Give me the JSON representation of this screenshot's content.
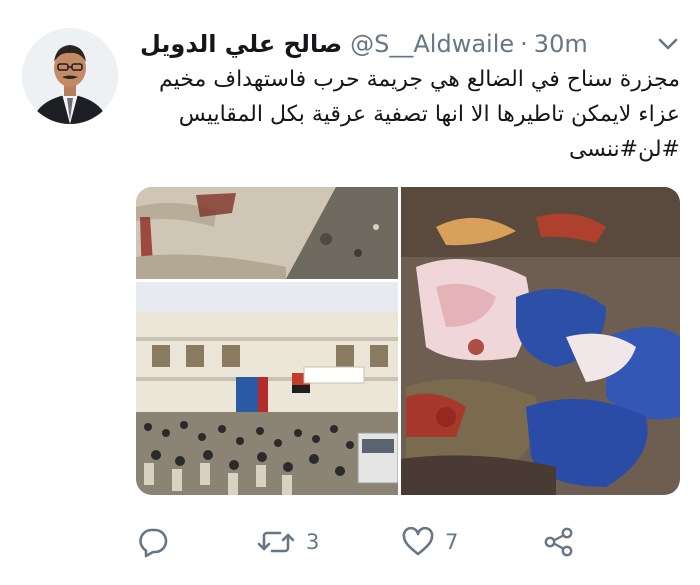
{
  "tweet": {
    "author": {
      "display_name": "صالح علي الدويل",
      "handle": "@S__Aldwaile",
      "separator": "·",
      "time": "30m"
    },
    "text_lines": [
      "مجزرة سناح في الضالع هي جريمة حرب فاستهداف مخيم",
      "عزاء لايمكن تاطيرها الا انها تصفية عرقية بكل المقاييس",
      "#لن#ننسى"
    ],
    "stats": {
      "retweets": "3",
      "likes": "7"
    },
    "media": {
      "images": [
        "photo-rubble-wall",
        "photo-school-building-crowd",
        "photo-covered-bodies"
      ]
    }
  },
  "colors": {
    "text_primary": "#14171a",
    "text_secondary": "#657786",
    "icon": "#657786"
  },
  "icons": [
    "chevron-down-icon",
    "reply-icon",
    "retweet-icon",
    "like-icon",
    "share-icon"
  ]
}
